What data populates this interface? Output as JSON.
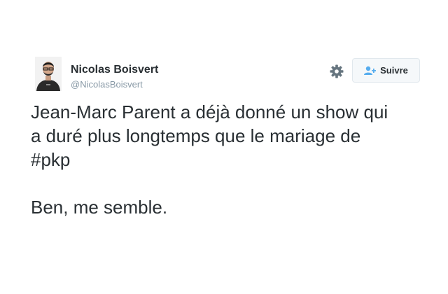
{
  "author": {
    "name": "Nicolas Boisvert",
    "handle": "@NicolasBoisvert"
  },
  "follow_button": {
    "label": "Suivre",
    "icon": "follow-person-plus-icon"
  },
  "settings": {
    "icon": "gear-icon"
  },
  "tweet": {
    "line1": "Jean-Marc Parent a déjà donné un show qui",
    "line2": "a duré plus longtemps que le mariage de",
    "hashtag": "#pkp",
    "line4": "Ben, me semble."
  },
  "colors": {
    "text": "#292f33",
    "muted": "#8899a6",
    "accent": "#55acee"
  }
}
